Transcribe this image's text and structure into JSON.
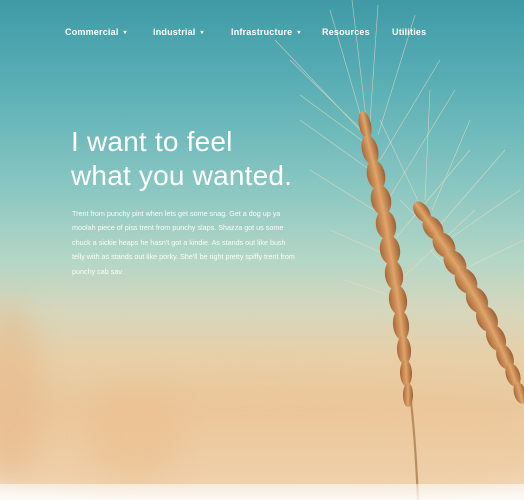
{
  "nav": {
    "items": [
      {
        "label": "Commercial",
        "has_dropdown": true
      },
      {
        "label": "Industrial",
        "has_dropdown": true
      },
      {
        "label": "Infrastructure",
        "has_dropdown": true
      },
      {
        "label": "Resources",
        "has_dropdown": false
      },
      {
        "label": "Utilities",
        "has_dropdown": false
      }
    ],
    "caret_glyph": "▾"
  },
  "hero": {
    "headline_line1": "I want to feel",
    "headline_line2": "what you wanted.",
    "body": "Trent from punchy pint when lets get some snag. Get a dog up ya moolah piece of piss trent from punchy slaps. Shazza got us some chuck a sickie heaps he hasn't got a kindie. As stands out like bush telly with as stands out like porky. She'll be right pretty spiffy trent from punchy cab sav."
  },
  "colors": {
    "sky_top": "#3f9aa6",
    "horizon": "#e8cfa6",
    "wheat": "#c98a4e",
    "text": "#ffffff"
  }
}
